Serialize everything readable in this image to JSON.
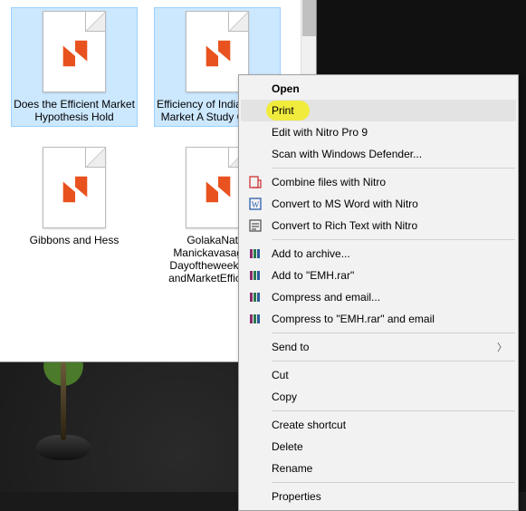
{
  "files": [
    {
      "label": "Does the Efficient Market Hypothesis Hold",
      "selected": true
    },
    {
      "label": "Efficiency of Indian Stock Market A Study Of NSE",
      "selected": true
    },
    {
      "label": "Gibbons and Hess",
      "selected": false
    },
    {
      "label": "GolakaNath-Manickavasagam-Dayoftheweekeffect andMarketEfficiency",
      "selected": false
    }
  ],
  "ctx": {
    "open": "Open",
    "print": "Print",
    "editNitro": "Edit with Nitro Pro 9",
    "defender": "Scan with Windows Defender...",
    "combine": "Combine files with Nitro",
    "toWord": "Convert to MS Word with Nitro",
    "toRich": "Convert to Rich Text with Nitro",
    "addArchive": "Add to archive...",
    "addEmh": "Add to \"EMH.rar\"",
    "compressEmail": "Compress and email...",
    "compressEmhEmail": "Compress to \"EMH.rar\" and email",
    "sendTo": "Send to",
    "cut": "Cut",
    "copy": "Copy",
    "shortcut": "Create shortcut",
    "delete": "Delete",
    "rename": "Rename",
    "properties": "Properties"
  }
}
